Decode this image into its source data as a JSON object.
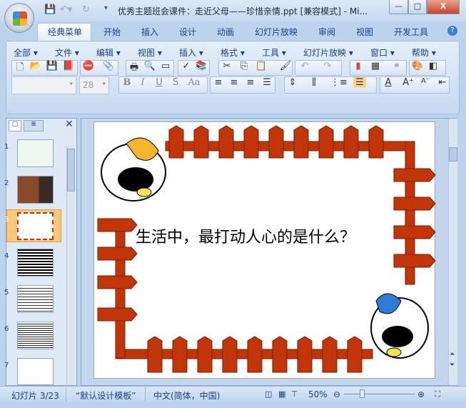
{
  "window": {
    "title": "优秀主题班会课件：走近父母——珍惜亲情.ppt [兼容模式] - Mi...",
    "minimize": "—",
    "maximize": "□",
    "close": "X"
  },
  "tabs": [
    "经典菜单",
    "开始",
    "插入",
    "设计",
    "动画",
    "幻灯片放映",
    "审阅",
    "视图",
    "开发工具"
  ],
  "menus": [
    "全部",
    "文件",
    "编辑",
    "视图",
    "插入",
    "格式",
    "工具",
    "幻灯片放映",
    "窗口",
    "帮助"
  ],
  "font": {
    "name": "",
    "size": "28"
  },
  "format_buttons": [
    "B",
    "I",
    "U",
    "S",
    "Aa"
  ],
  "slides": {
    "numbers": [
      "1",
      "2",
      "3",
      "4",
      "5",
      "6",
      "7"
    ],
    "selected": "3"
  },
  "slide": {
    "text": "生活中，最打动人心的是什么？"
  },
  "status": {
    "slide": "幻灯片 3/23",
    "template": "“默认设计模板”",
    "language": "中文(简体，中国)",
    "zoom": "50%"
  },
  "colors": {
    "fence": "#c23508",
    "accent": "#f7b42c"
  }
}
